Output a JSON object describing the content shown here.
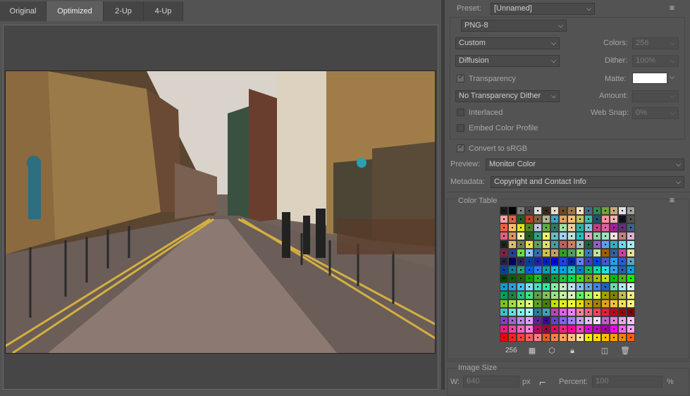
{
  "tabs": [
    {
      "label": "Original"
    },
    {
      "label": "Optimized"
    },
    {
      "label": "2-Up"
    },
    {
      "label": "4-Up"
    }
  ],
  "active_tab": "Optimized",
  "settings": {
    "preset_label": "Preset:",
    "preset_value": "[Unnamed]",
    "format_value": "PNG-8",
    "reduction_value": "Custom",
    "colors_label": "Colors:",
    "colors_value": "256",
    "dither_algo_value": "Diffusion",
    "dither_label": "Dither:",
    "dither_value": "100%",
    "transparency_label": "Transparency",
    "transparency_checked": true,
    "matte_label": "Matte:",
    "matte_color": "#ffffff",
    "transparency_dither_value": "No Transparency Dither",
    "amount_label": "Amount:",
    "amount_value": "",
    "interlaced_label": "Interlaced",
    "interlaced_checked": false,
    "web_snap_label": "Web Snap:",
    "web_snap_value": "0%",
    "embed_profile_label": "Embed Color Profile",
    "embed_profile_checked": false,
    "convert_srgb_label": "Convert to sRGB",
    "convert_srgb_checked": true,
    "preview_label": "Preview:",
    "preview_value": "Monitor Color",
    "metadata_label": "Metadata:",
    "metadata_value": "Copyright and Contact Info"
  },
  "color_table": {
    "title": "Color Table",
    "count": "256",
    "colors": [
      "#1a1a1a",
      "#000000",
      "#7a7a7a",
      "#4a4a4a",
      "#dcdcdc",
      "#3a2a1a",
      "#e8d8c8",
      "#6a4a2a",
      "#a07840",
      "#ffe0c0",
      "#4a6a8a",
      "#2a8a4a",
      "#70a040",
      "#c8a878",
      "#e0e0e0",
      "#a0a0a0",
      "#f0a0a0",
      "#e06040",
      "#206020",
      "#c04020",
      "#806040",
      "#b0b090",
      "#40a0c0",
      "#e0a060",
      "#f0c070",
      "#c0c060",
      "#30c0a0",
      "#205070",
      "#ff90a0",
      "#f0b0b0",
      "#101020",
      "#505050",
      "#f06040",
      "#ffc060",
      "#e0e020",
      "#4a8a20",
      "#c0c0e0",
      "#5ab040",
      "#2a7a60",
      "#a0e0a0",
      "#f0d0a0",
      "#30b0a0",
      "#80c0e0",
      "#c04080",
      "#e060a0",
      "#a020a0",
      "#603080",
      "#406080",
      "#e06080",
      "#e09060",
      "#f0f0a0",
      "#206020",
      "#30a080",
      "#f0f060",
      "#60c0c0",
      "#a0d0f0",
      "#c0e0e0",
      "#20c0c0",
      "#e0a0c0",
      "#90d0a0",
      "#a0e0c0",
      "#f0e0e0",
      "#c08080",
      "#e0b0d0",
      "#202020",
      "#e0c060",
      "#708050",
      "#f0e040",
      "#60a060",
      "#e0e060",
      "#40a0a0",
      "#c06060",
      "#d08060",
      "#a0c0c0",
      "#206040",
      "#9060c0",
      "#60a0f0",
      "#30b0c0",
      "#60e0f0",
      "#a0f0f0",
      "#802040",
      "#2040a0",
      "#60e040",
      "#90c0f0",
      "#3070b0",
      "#d0c040",
      "#c0a060",
      "#30a020",
      "#50a060",
      "#a0e060",
      "#3080c0",
      "#c0e0a0",
      "#a06000",
      "#3060a0",
      "#d040a0",
      "#e0e0a0",
      "#202040",
      "#000060",
      "#302060",
      "#0040a0",
      "#2020a0",
      "#0020c0",
      "#0000f0",
      "#2040f0",
      "#0020a0",
      "#6080f0",
      "#4040c0",
      "#0040e0",
      "#4060c0",
      "#20a0f0",
      "#2060e0",
      "#60a0c0",
      "#0040a0",
      "#0080a0",
      "#20a080",
      "#0060e0",
      "#2080f0",
      "#00a0a0",
      "#00c0e0",
      "#00a0f0",
      "#20c0c0",
      "#0080c0",
      "#00c060",
      "#00e0a0",
      "#20e0e0",
      "#30a0f0",
      "#2060b0",
      "#00a0e0",
      "#004000",
      "#006000",
      "#206000",
      "#00a000",
      "#20c020",
      "#006020",
      "#00a040",
      "#20c040",
      "#00e040",
      "#40e000",
      "#80a000",
      "#a0c000",
      "#c0e020",
      "#00c000",
      "#40c000",
      "#00ff00",
      "#00a0c0",
      "#20a0e0",
      "#40c0f0",
      "#80e0f0",
      "#40e0c0",
      "#20f0a0",
      "#80f0a0",
      "#c0f0c0",
      "#c0e0f0",
      "#80c0f0",
      "#60a0f0",
      "#4080f0",
      "#2060c0",
      "#60e0a0",
      "#a0f0f0",
      "#e0f0f0",
      "#00a060",
      "#208040",
      "#20c080",
      "#40e080",
      "#60a040",
      "#80c060",
      "#a0e080",
      "#c0f0a0",
      "#e0f0c0",
      "#60f060",
      "#a0ff60",
      "#e0ff60",
      "#a0a000",
      "#808000",
      "#c0c040",
      "#f0f080",
      "#80c020",
      "#a0e040",
      "#c0f060",
      "#e0ff80",
      "#60a020",
      "#408000",
      "#c0e000",
      "#e0f020",
      "#f0ff40",
      "#e0e000",
      "#c0a000",
      "#a08000",
      "#e0a020",
      "#f0c040",
      "#f0e060",
      "#ffff80",
      "#40c0c0",
      "#60e0e0",
      "#80f0f0",
      "#a0ffff",
      "#2080a0",
      "#40a0c0",
      "#c040c0",
      "#e060e0",
      "#f080f0",
      "#ff80a0",
      "#ff6080",
      "#ff4060",
      "#e02040",
      "#c00020",
      "#a00000",
      "#800000",
      "#8040c0",
      "#a060e0",
      "#c080f0",
      "#e0a0ff",
      "#6020a0",
      "#4000a0",
      "#6040e0",
      "#8060f0",
      "#a080ff",
      "#c0a0ff",
      "#e0c0ff",
      "#f0e0ff",
      "#c060c0",
      "#e080e0",
      "#f0a0f0",
      "#ffc0ff",
      "#e02080",
      "#ff40a0",
      "#ff60c0",
      "#ff80e0",
      "#c00060",
      "#a00040",
      "#f00060",
      "#ff2080",
      "#ff00a0",
      "#ff40c0",
      "#e000e0",
      "#c000c0",
      "#a000a0",
      "#ff00ff",
      "#ff60ff",
      "#ffa0ff",
      "#f00000",
      "#ff2020",
      "#ff4040",
      "#ff6060",
      "#ff8080",
      "#e06020",
      "#ff8040",
      "#ffa060",
      "#ffc080",
      "#ffe0a0",
      "#f0f000",
      "#ffe000",
      "#ffc000",
      "#ffa000",
      "#ff8000",
      "#ff6000"
    ]
  },
  "image_size": {
    "title": "Image Size",
    "w_label": "W:",
    "w_value": "640",
    "w_unit": "px",
    "percent_label": "Percent:",
    "percent_value": "100",
    "percent_unit": "%"
  },
  "icons": [
    "panel-menu-icon",
    "chevron-down-icon",
    "image-icon",
    "cube-icon",
    "lock-icon",
    "new-color-icon",
    "trash-icon",
    "link-icon"
  ]
}
